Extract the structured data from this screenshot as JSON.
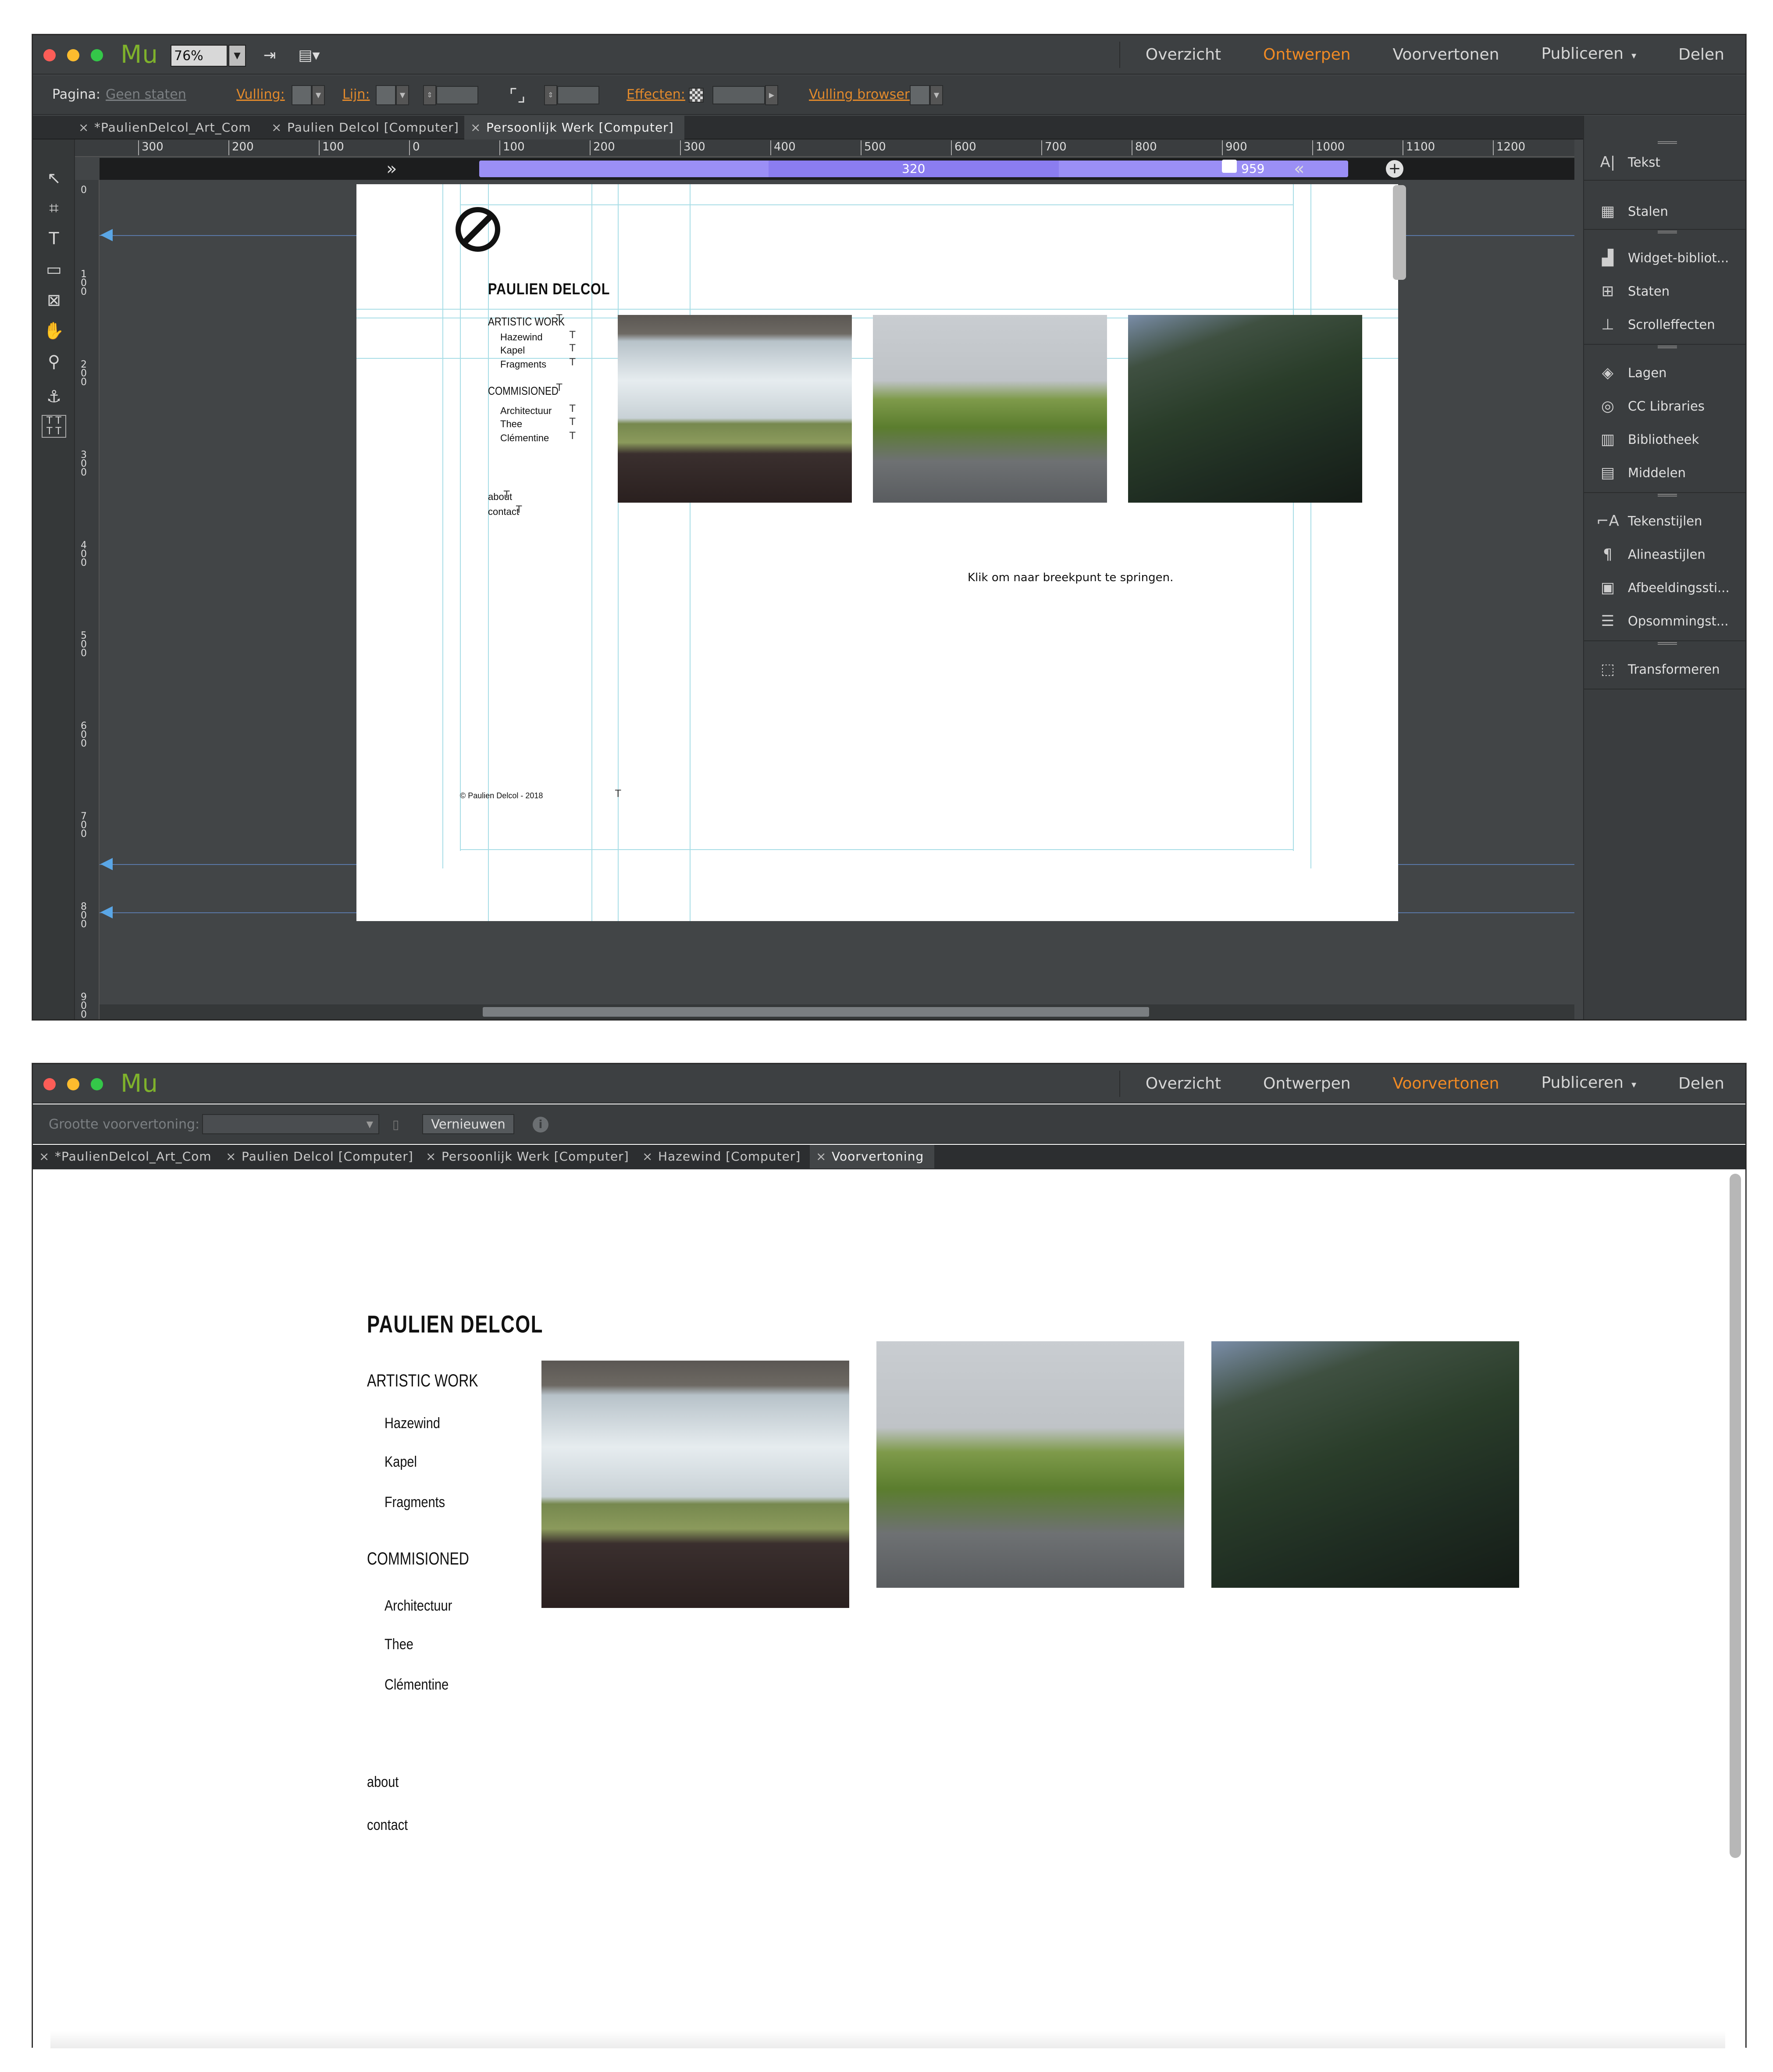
{
  "app": {
    "logo": "Mu"
  },
  "design_window": {
    "zoom": "76%",
    "nav": [
      {
        "label": "Overzicht",
        "active": false
      },
      {
        "label": "Ontwerpen",
        "active": true
      },
      {
        "label": "Voorvertonen",
        "active": false
      },
      {
        "label": "Publiceren",
        "active": false,
        "caret": "▾"
      },
      {
        "label": "Delen",
        "active": false
      }
    ],
    "control_bar": {
      "page_label": "Pagina:",
      "page_value": "Geen staten",
      "fill_label": "Vulling:",
      "stroke_label": "Lijn:",
      "effects_label": "Effecten:",
      "browser_fill_label": "Vulling browser:"
    },
    "tabs": [
      {
        "label": "*PaulienDelcol_Art_Com",
        "close": "×",
        "active": false
      },
      {
        "label": "Paulien Delcol [Computer]",
        "close": "×",
        "active": false
      },
      {
        "label": "Persoonlijk Werk [Computer]",
        "close": "×",
        "active": true
      }
    ],
    "ruler_h": [
      "300",
      "200",
      "100",
      "0",
      "100",
      "200",
      "300",
      "400",
      "500",
      "600",
      "700",
      "800",
      "900",
      "1000",
      "1100",
      "1200"
    ],
    "ruler_v": [
      "0",
      "100",
      "200",
      "300",
      "400",
      "500",
      "600",
      "700",
      "800",
      "900"
    ],
    "breakpoint": {
      "value": "320",
      "max": "959"
    },
    "page": {
      "title": "PAULIEN DELCOL",
      "section1": "ARTISTIC WORK",
      "section1_items": [
        "Hazewind",
        "Kapel",
        "Fragments"
      ],
      "section2": "COMMISIONED",
      "section2_items": [
        "Architectuur",
        "Thee",
        "Clémentine"
      ],
      "links": [
        "about",
        "contact"
      ],
      "footer": "© Paulien Delcol  - 2018",
      "hint": "Klik om naar breekpunt te springen."
    },
    "panel": [
      {
        "label": "Tekst",
        "icon": "A|"
      },
      {
        "label": "Stalen",
        "icon": "▦"
      },
      {
        "label": "Widget-bibliot...",
        "icon": "▟"
      },
      {
        "label": "Staten",
        "icon": "⊞"
      },
      {
        "label": "Scrolleffecten",
        "icon": "⊥"
      },
      {
        "label": "Lagen",
        "icon": "◈"
      },
      {
        "label": "CC Libraries",
        "icon": "◎"
      },
      {
        "label": "Bibliotheek",
        "icon": "▥"
      },
      {
        "label": "Middelen",
        "icon": "▤"
      },
      {
        "label": "Tekenstijlen",
        "icon": "⌐A"
      },
      {
        "label": "Alineastijlen",
        "icon": "¶"
      },
      {
        "label": "Afbeeldingssti...",
        "icon": "▣"
      },
      {
        "label": "Opsommingst...",
        "icon": "☰"
      },
      {
        "label": "Transformeren",
        "icon": "⬚"
      }
    ]
  },
  "preview_window": {
    "nav": [
      {
        "label": "Overzicht",
        "active": false
      },
      {
        "label": "Ontwerpen",
        "active": false
      },
      {
        "label": "Voorvertonen",
        "active": true
      },
      {
        "label": "Publiceren",
        "active": false,
        "caret": "▾"
      },
      {
        "label": "Delen",
        "active": false
      }
    ],
    "control_bar": {
      "size_label": "Grootte voorvertoning:",
      "refresh_label": "Vernieuwen",
      "info_icon": "i"
    },
    "tabs": [
      {
        "label": "*PaulienDelcol_Art_Com",
        "close": "×",
        "active": false
      },
      {
        "label": "Paulien Delcol [Computer]",
        "close": "×",
        "active": false
      },
      {
        "label": "Persoonlijk Werk [Computer]",
        "close": "×",
        "active": false
      },
      {
        "label": "Hazewind [Computer]",
        "close": "×",
        "active": false
      },
      {
        "label": "Voorvertoning",
        "close": "×",
        "active": true
      }
    ],
    "page": {
      "title": "PAULIEN DELCOL",
      "section1": "ARTISTIC WORK",
      "section1_items": [
        "Hazewind",
        "Kapel",
        "Fragments"
      ],
      "section2": "COMMISIONED",
      "section2_items": [
        "Architectuur",
        "Thee",
        "Clémentine"
      ],
      "links": [
        "about",
        "contact"
      ]
    }
  }
}
